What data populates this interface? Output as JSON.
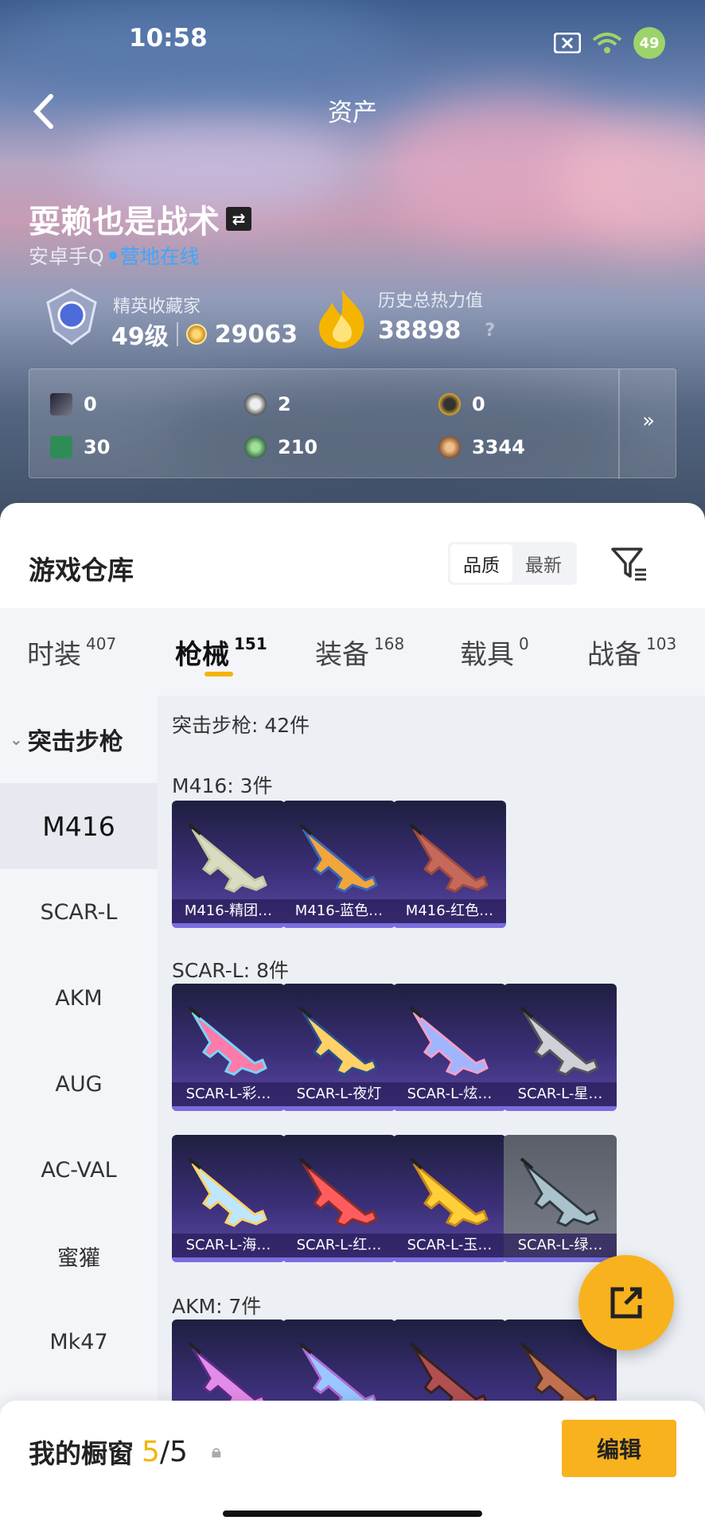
{
  "status": {
    "time": "10:58",
    "battery": "49"
  },
  "header": {
    "title": "资产"
  },
  "profile": {
    "name": "耍赖也是战术",
    "platform": "安卓手Q",
    "online": "营地在线",
    "rank_title": "精英收藏家",
    "level": "49级",
    "coins": "29063",
    "heat_caption": "历史总热力值",
    "heat_value": "38898",
    "heat_help": "?"
  },
  "currencies": [
    {
      "value": "0",
      "icon": "card-icon"
    },
    {
      "value": "2",
      "icon": "silver-coin-icon"
    },
    {
      "value": "0",
      "icon": "gold-token-icon"
    },
    {
      "value": "30",
      "icon": "green-ticket-icon"
    },
    {
      "value": "210",
      "icon": "green-orb-icon"
    },
    {
      "value": "3344",
      "icon": "bronze-coin-icon"
    }
  ],
  "warehouse": {
    "title": "游戏仓库",
    "sort": [
      "品质",
      "最新"
    ]
  },
  "tabs": [
    {
      "label": "时装",
      "count": "407"
    },
    {
      "label": "枪械",
      "count": "151"
    },
    {
      "label": "装备",
      "count": "168"
    },
    {
      "label": "载具",
      "count": "0"
    },
    {
      "label": "战备",
      "count": "103"
    }
  ],
  "sidebar": {
    "category": "突击步枪",
    "items": [
      "M416",
      "SCAR-L",
      "AKM",
      "AUG",
      "AC-VAL",
      "蜜獾",
      "Mk47"
    ]
  },
  "content": {
    "summary": "突击步枪: 42件",
    "sections": [
      {
        "title": "M416: 3件",
        "items": [
          "M416-精团…",
          "M416-蓝色…",
          "M416-红色…"
        ]
      },
      {
        "title": "SCAR-L: 8件",
        "items": [
          "SCAR-L-彩…",
          "SCAR-L-夜灯",
          "SCAR-L-炫…",
          "SCAR-L-星…",
          "SCAR-L-海…",
          "SCAR-L-红…",
          "SCAR-L-玉…",
          "SCAR-L-绿…"
        ]
      },
      {
        "title": "AKM: 7件",
        "items": [
          "",
          "",
          "",
          ""
        ]
      }
    ]
  },
  "bottom": {
    "label": "我的橱窗",
    "count_current": "5",
    "count_sep": "/",
    "count_total": "5",
    "edit": "编辑"
  },
  "colors": {
    "accent": "#f8b21d",
    "link": "#3ea6ff"
  }
}
